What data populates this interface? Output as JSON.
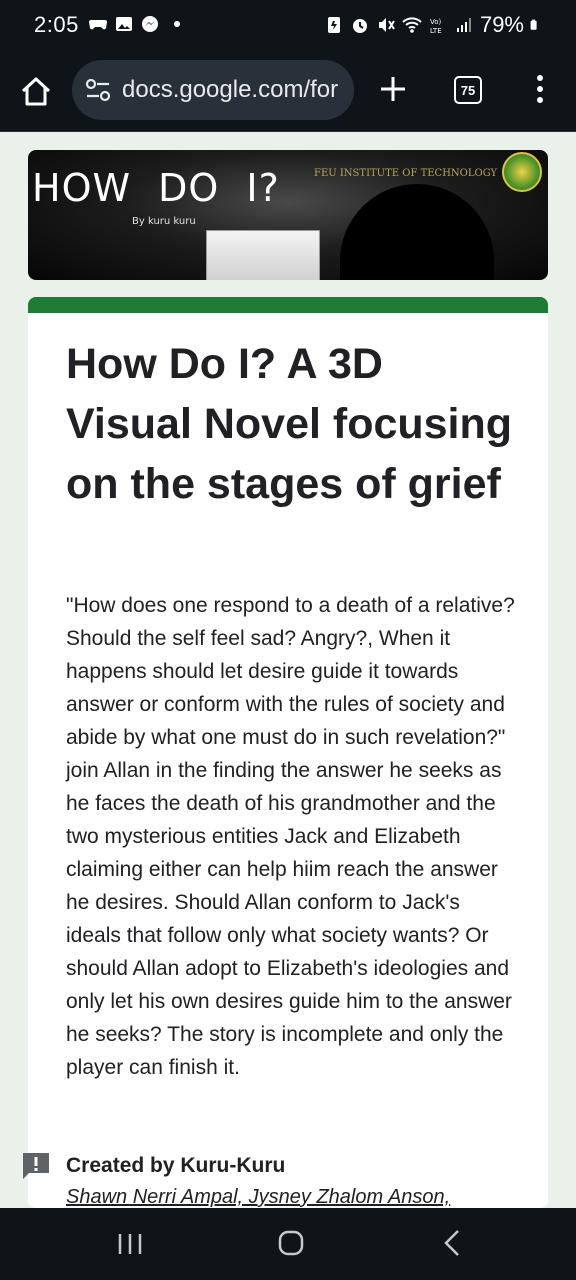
{
  "status_bar": {
    "time": "2:05",
    "battery": "79%",
    "network": "VoLTE"
  },
  "browser": {
    "url": "docs.google.com/for",
    "tab_count": "75"
  },
  "banner": {
    "title": "HOW DO I?",
    "byline": "By kuru kuru",
    "institute": "FEU INSTITUTE OF TECHNOLOGY"
  },
  "form": {
    "accent_color": "#1e7b34",
    "title": "How Do I? A 3D Visual Novel focusing on the stages of grief",
    "description": "\"How does one respond to a death of a relative? Should the self feel sad? Angry?, When it happens should let desire guide it towards answer or conform with the rules of society and abide by what one must do in such revelation?\" join Allan in the finding the answer he seeks as he faces the death of his grandmother and the two mysterious entities Jack and Elizabeth claiming either can help hiim reach the answer he desires. Should Allan conform to Jack's ideals that follow only what society wants? Or should Allan adopt to Elizabeth's ideologies and only let his own desires guide him to the answer he seeks? The story is incomplete and only the player can finish it.",
    "creator_label": "Created by Kuru-Kuru",
    "creator_names": "Shawn Nerri Ampal, Jysney Zhalom Anson,"
  },
  "icons": [
    "home-icon",
    "tune-icon",
    "plus-icon",
    "tab-switcher-icon",
    "more-vert-icon",
    "report-icon",
    "recents-icon",
    "nav-home-icon",
    "back-icon"
  ]
}
